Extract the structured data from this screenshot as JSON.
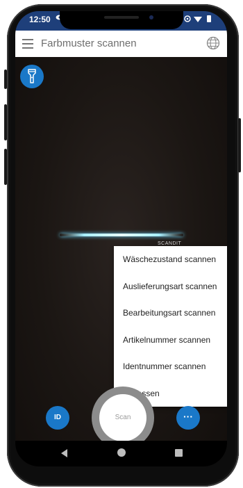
{
  "status_bar": {
    "time": "12:50",
    "left_icon": "eye-icon",
    "right_icons": [
      "battery-saver-icon",
      "vpn-icon",
      "wifi-icon",
      "battery-icon"
    ]
  },
  "app_bar": {
    "title": "Farbmuster scannen",
    "menu_icon": "hamburger-menu-icon",
    "action_icon": "globe-icon"
  },
  "camera": {
    "torch_icon": "flashlight-icon",
    "watermark": "SCANDIT"
  },
  "popup_menu": {
    "items": [
      {
        "label": "Wäschezustand scannen"
      },
      {
        "label": "Auslieferungsart scannen"
      },
      {
        "label": "Bearbeitungsart scannen"
      },
      {
        "label": "Artikelnummer scannen"
      },
      {
        "label": "Identnummer scannen"
      },
      {
        "label": "Verlassen"
      }
    ]
  },
  "bottom_controls": {
    "id_label": "ID",
    "scan_label": "Scan",
    "more_label": "···"
  },
  "nav_bar": {
    "back_icon": "back-triangle-icon",
    "home_icon": "home-circle-icon",
    "recents_icon": "recents-square-icon"
  },
  "colors": {
    "status_bar": "#1e3f7a",
    "accent": "#1a78c8",
    "camera_bg": "#1c1714"
  }
}
